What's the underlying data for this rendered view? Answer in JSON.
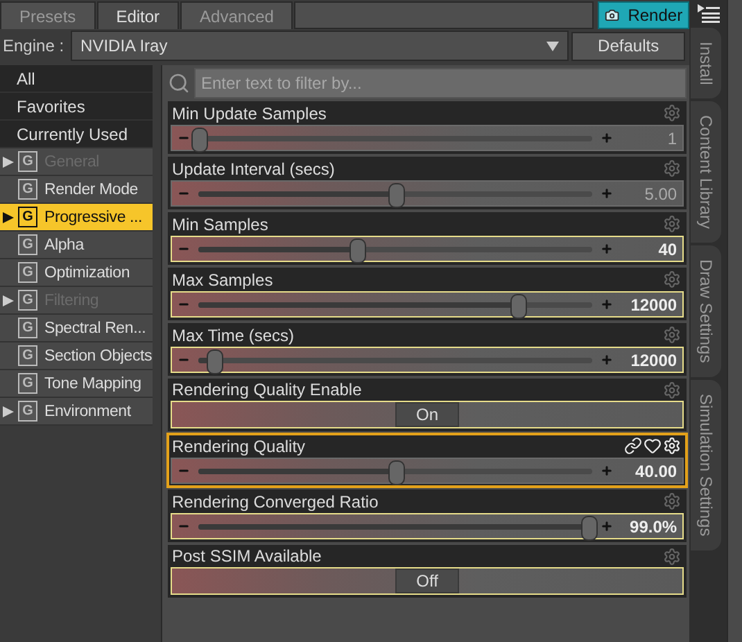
{
  "tabs": [
    {
      "label": "Presets",
      "selected": false
    },
    {
      "label": "Editor",
      "selected": true
    },
    {
      "label": "Advanced",
      "selected": false
    }
  ],
  "render_button": "Render",
  "engine": {
    "label": "Engine :",
    "value": "NVIDIA Iray"
  },
  "defaults_button": "Defaults",
  "sidebar": [
    {
      "label": "All",
      "kind": "filter",
      "selected": false
    },
    {
      "label": "Favorites",
      "kind": "filter",
      "selected": false
    },
    {
      "label": "Currently Used",
      "kind": "filter",
      "selected": false
    },
    {
      "label": "General",
      "kind": "group",
      "icon": "G",
      "expandable": true,
      "disabled": true,
      "selected": false
    },
    {
      "label": "Render Mode",
      "kind": "group",
      "icon": "G",
      "expandable": false,
      "disabled": false,
      "selected": false
    },
    {
      "label": "Progressive ...",
      "kind": "group",
      "icon": "G",
      "expandable": true,
      "disabled": false,
      "selected": true
    },
    {
      "label": "Alpha",
      "kind": "group",
      "icon": "G",
      "expandable": false,
      "disabled": false,
      "selected": false
    },
    {
      "label": "Optimization",
      "kind": "group",
      "icon": "G",
      "expandable": false,
      "disabled": false,
      "selected": false
    },
    {
      "label": "Filtering",
      "kind": "group",
      "icon": "G",
      "expandable": true,
      "disabled": true,
      "selected": false
    },
    {
      "label": "Spectral Ren...",
      "kind": "group",
      "icon": "G",
      "expandable": false,
      "disabled": false,
      "selected": false
    },
    {
      "label": "Section Objects",
      "kind": "group",
      "icon": "G",
      "expandable": false,
      "disabled": false,
      "selected": false
    },
    {
      "label": "Tone Mapping",
      "kind": "group",
      "icon": "G",
      "expandable": false,
      "disabled": false,
      "selected": false
    },
    {
      "label": "Environment",
      "kind": "group",
      "icon": "G",
      "expandable": true,
      "disabled": false,
      "selected": false
    }
  ],
  "filter": {
    "placeholder": "Enter text to filter by..."
  },
  "properties": [
    {
      "name": "Min Update Samples",
      "kind": "slider",
      "level": 0.0,
      "value": "1",
      "modified": false,
      "selected": false
    },
    {
      "name": "Update Interval (secs)",
      "kind": "slider",
      "level": 0.5,
      "value": "5.00",
      "modified": false,
      "selected": false
    },
    {
      "name": "Min Samples",
      "kind": "slider",
      "level": 0.4,
      "value": "40",
      "modified": true,
      "selected": false
    },
    {
      "name": "Max Samples",
      "kind": "slider",
      "level": 0.81,
      "value": "12000",
      "modified": true,
      "selected": false
    },
    {
      "name": "Max Time (secs)",
      "kind": "slider",
      "level": 0.04,
      "value": "12000",
      "modified": true,
      "selected": false
    },
    {
      "name": "Rendering Quality Enable",
      "kind": "toggle",
      "value": "On",
      "modified": true,
      "selected": false
    },
    {
      "name": "Rendering Quality",
      "kind": "slider",
      "level": 0.5,
      "value": "40.00",
      "modified": false,
      "selected": true
    },
    {
      "name": "Rendering Converged Ratio",
      "kind": "slider",
      "level": 0.99,
      "value": "99.0%",
      "modified": true,
      "selected": false
    },
    {
      "name": "Post SSIM Available",
      "kind": "toggle",
      "value": "Off",
      "modified": true,
      "selected": false
    }
  ],
  "side_tabs": [
    "Install",
    "Content Library",
    "Draw Settings",
    "Simulation Settings"
  ]
}
